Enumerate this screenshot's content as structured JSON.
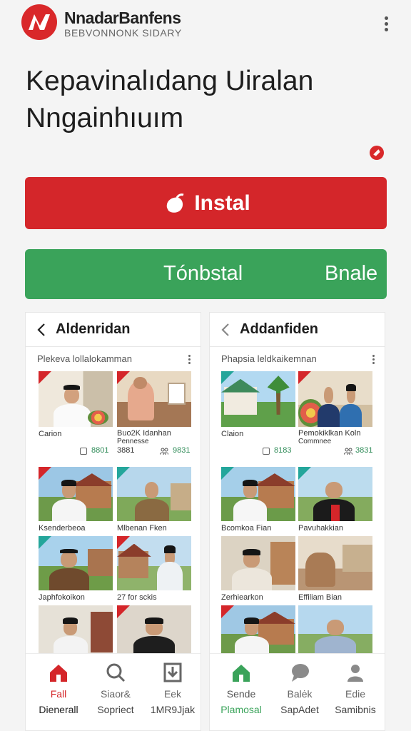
{
  "app": {
    "name": "NnadarBanfens",
    "subtitle": "BEBVONNONK SIDARY"
  },
  "headline": {
    "line1": "Kepavinalıdang Uiralan",
    "line2": "Nngainhıuım"
  },
  "actions": {
    "install_label": "Instal",
    "secondary_label": "Tónbstal",
    "secondary_right_label": "Bnale"
  },
  "colors": {
    "accent_red": "#d4262a",
    "accent_green": "#3aa35a"
  },
  "panels": [
    {
      "title": "Aldenridan",
      "subtitle": "Plekeva lollalokamman",
      "cards": [
        {
          "caption": "Carion",
          "lines": [],
          "stat_a": "8801",
          "stat_b": "3881"
        },
        {
          "caption": "Buo2K Idanhan",
          "lines": [
            "Pennesse"
          ],
          "stat_a": "",
          "stat_b": "9831"
        },
        {
          "caption": "Ksenderbeoa",
          "lines": [],
          "stat_a": "",
          "stat_b": ""
        },
        {
          "caption": "Mlbenan Fken",
          "lines": [],
          "stat_a": "",
          "stat_b": ""
        },
        {
          "caption": "Japhfokoikon",
          "lines": [],
          "stat_a": "",
          "stat_b": ""
        },
        {
          "caption": "27 for sckis",
          "lines": [],
          "stat_a": "",
          "stat_b": ""
        },
        {
          "caption": "",
          "lines": [],
          "stat_a": "",
          "stat_b": ""
        },
        {
          "caption": "",
          "lines": [],
          "stat_a": "",
          "stat_b": ""
        }
      ],
      "nav": [
        {
          "icon": "home-icon",
          "label": "Fall",
          "sub": "Dienerall"
        },
        {
          "icon": "search-icon",
          "label": "Siaor&",
          "sub": "Sopriect"
        },
        {
          "icon": "download-icon",
          "label": "Eek",
          "sub": "1MR9Jjak"
        }
      ]
    },
    {
      "title": "Addanfiden",
      "subtitle": "Phapsia leldkaikemnan",
      "cards": [
        {
          "caption": "Claion",
          "lines": [],
          "stat_a": "8183",
          "stat_b": ""
        },
        {
          "caption": "Pemokiklkan Koln",
          "lines": [
            "Commnee"
          ],
          "stat_a": "",
          "stat_b": "3831"
        },
        {
          "caption": "Bcomkoa Fian",
          "lines": [],
          "stat_a": "",
          "stat_b": ""
        },
        {
          "caption": "Pavuhakkian",
          "lines": [],
          "stat_a": "",
          "stat_b": ""
        },
        {
          "caption": "Zerhiearkon",
          "lines": [],
          "stat_a": "",
          "stat_b": ""
        },
        {
          "caption": "Effiliam Bian",
          "lines": [],
          "stat_a": "",
          "stat_b": ""
        },
        {
          "caption": "",
          "lines": [],
          "stat_a": "",
          "stat_b": ""
        },
        {
          "caption": "",
          "lines": [],
          "stat_a": "",
          "stat_b": ""
        }
      ],
      "nav": [
        {
          "icon": "home-icon",
          "label": "Sende",
          "sub": "Plamosal"
        },
        {
          "icon": "chat-icon",
          "label": "Balėk",
          "sub": "SapAdet"
        },
        {
          "icon": "profile-icon",
          "label": "Edie",
          "sub": "Samibnis"
        }
      ]
    }
  ]
}
